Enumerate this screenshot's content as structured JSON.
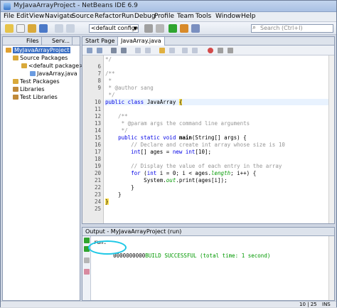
{
  "window": {
    "title": "MyJavaArrayProject - NetBeans IDE 6.9"
  },
  "menu": [
    "File",
    "Edit",
    "View",
    "Navigate",
    "Source",
    "Refactor",
    "Run",
    "Debug",
    "Profile",
    "Team",
    "Tools",
    "Window",
    "Help"
  ],
  "toolbar": {
    "config": "<default config>",
    "search_placeholder": "Search (Ctrl+I)"
  },
  "left_panel": {
    "tabs": [
      "Files",
      "Serv..."
    ],
    "tree": [
      {
        "label": "MyJavaArrayProject",
        "selected": true
      },
      {
        "label": "Source Packages"
      },
      {
        "label": "<default package>"
      },
      {
        "label": "JavaArray.java"
      },
      {
        "label": "Test Packages"
      },
      {
        "label": "Libraries"
      },
      {
        "label": "Test Libraries"
      }
    ]
  },
  "editor": {
    "tabs": [
      "Start Page",
      "JavaArray.java"
    ],
    "line_numbers": [
      "",
      "",
      "",
      "",
      "",
      "",
      "",
      "10",
      "",
      "",
      "",
      "",
      "",
      "",
      "",
      "",
      "",
      "",
      "",
      "",
      "",
      "",
      "",
      "",
      ""
    ],
    "lines": [
      {
        "num": "",
        "text": "*/"
      },
      {
        "num": "6",
        "text": ""
      },
      {
        "num": "7",
        "text": "/**"
      },
      {
        "num": "8",
        "text": " *"
      },
      {
        "num": "9",
        "text": " * @author sang"
      },
      {
        "num": "",
        "text": " */"
      },
      {
        "num": "10",
        "text": "public class JavaArray {"
      },
      {
        "num": "11",
        "text": ""
      },
      {
        "num": "12",
        "text": "    /**"
      },
      {
        "num": "13",
        "text": "     * @param args the command line arguments"
      },
      {
        "num": "14",
        "text": "     */"
      },
      {
        "num": "15",
        "text": "    public static void main(String[] args) {"
      },
      {
        "num": "16",
        "text": "        // Declare and create int array whose size is 10"
      },
      {
        "num": "17",
        "text": "        int[] ages = new int[10];"
      },
      {
        "num": "18",
        "text": ""
      },
      {
        "num": "19",
        "text": "        // Display the value of each entry in the array"
      },
      {
        "num": "20",
        "text": "        for (int i = 0; i < ages.length; i++) {"
      },
      {
        "num": "21",
        "text": "            System.out.print(ages[i]);"
      },
      {
        "num": "22",
        "text": "        }"
      },
      {
        "num": "23",
        "text": "    }"
      },
      {
        "num": "24",
        "text": "}"
      },
      {
        "num": "25",
        "text": ""
      }
    ]
  },
  "output": {
    "title": "Output - MyJavaArrayProject (run)",
    "run_label": "run:",
    "digits": "0000000000",
    "success": "BUILD SUCCESSFUL (total time: 1 second)"
  },
  "status": {
    "position": "10 | 25",
    "mode": "INS"
  },
  "colors": {
    "keyword": "#0000e6",
    "comment": "#969696",
    "success": "#009900",
    "highlight": "#1ec8e6"
  }
}
